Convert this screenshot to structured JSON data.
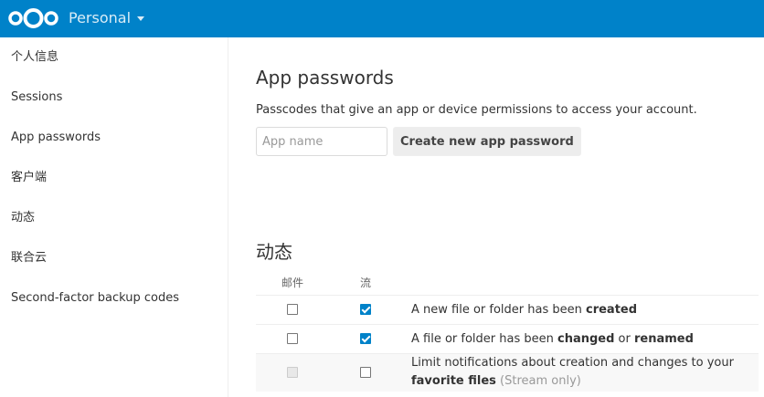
{
  "header": {
    "app_name": "Personal",
    "brand_color": "#0082c9"
  },
  "sidebar": {
    "items": [
      {
        "label": "个人信息"
      },
      {
        "label": "Sessions"
      },
      {
        "label": "App passwords"
      },
      {
        "label": "客户端"
      },
      {
        "label": "动态"
      },
      {
        "label": "联合云"
      },
      {
        "label": "Second-factor backup codes"
      }
    ]
  },
  "app_passwords": {
    "title": "App passwords",
    "description": "Passcodes that give an app or device permissions to access your account.",
    "name_placeholder": "App name",
    "create_label": "Create new app password"
  },
  "activity": {
    "title": "动态",
    "col_mail": "邮件",
    "col_stream": "流",
    "rows": [
      {
        "mail_checked": false,
        "stream_checked": true,
        "text_before": "A new file or folder has been ",
        "text_bold": "created"
      },
      {
        "mail_checked": false,
        "stream_checked": true,
        "text_before": "A file or folder has been ",
        "text_bold": "changed",
        "text_mid": " or ",
        "text_bold2": "renamed"
      },
      {
        "mail_disabled": true,
        "stream_checked": false,
        "text_before": "Limit notifications about creation and changes to your ",
        "text_bold": "favorite files",
        "text_muted": " (Stream only)"
      }
    ]
  }
}
